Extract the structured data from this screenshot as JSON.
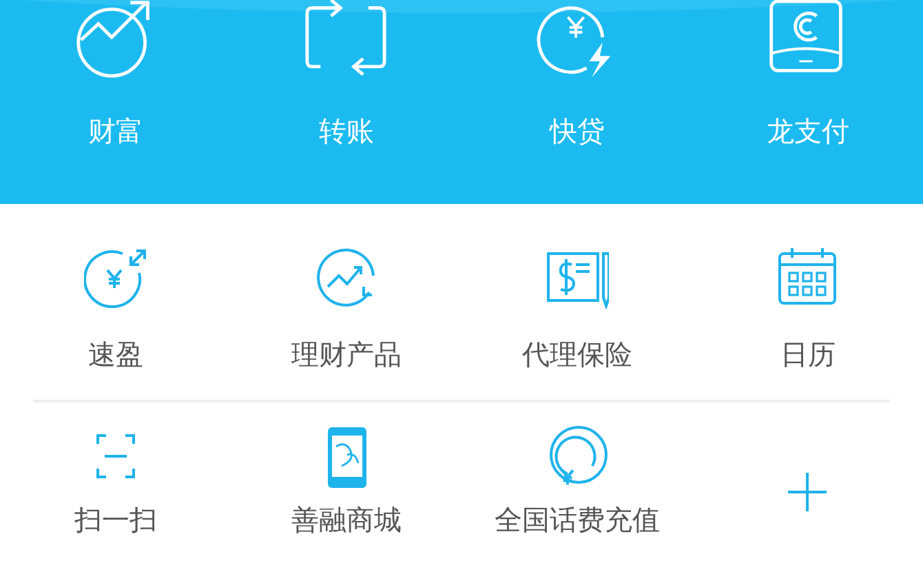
{
  "quick_actions": [
    {
      "label": "财富"
    },
    {
      "label": "转账"
    },
    {
      "label": "快贷"
    },
    {
      "label": "龙支付"
    }
  ],
  "services": [
    [
      {
        "label": "速盈"
      },
      {
        "label": "理财产品"
      },
      {
        "label": "代理保险"
      },
      {
        "label": "日历"
      }
    ],
    [
      {
        "label": "扫一扫"
      },
      {
        "label": "善融商城"
      },
      {
        "label": "全国话费充值"
      }
    ]
  ]
}
